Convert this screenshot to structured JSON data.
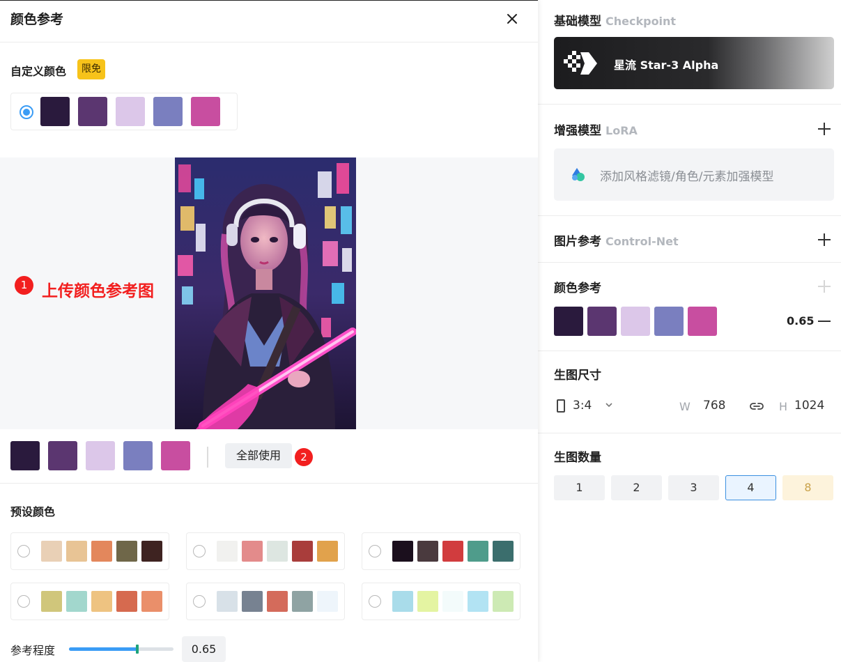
{
  "colors": {
    "accent": "#3a9cf5",
    "danger": "#f21f1f",
    "badge": "#f7c31a",
    "palette": [
      "#2a1a3d",
      "#5b3670",
      "#dcc7e9",
      "#7a7fbf",
      "#c84ea0"
    ]
  },
  "left_panel": {
    "title": "颜色参考",
    "custom": {
      "title": "自定义颜色",
      "badge": "限免"
    },
    "upload": {
      "step": "1",
      "label": "上传颜色参考图",
      "image_alt": "neon-guitar-girl-image"
    },
    "extracted": {
      "use_all_label": "全部使用",
      "step": "2"
    },
    "preset": {
      "title": "预设颜色",
      "palettes": [
        [
          "#e9d0b6",
          "#e8c495",
          "#e3875c",
          "#6f6749",
          "#3e2321"
        ],
        [
          "#f1f1ef",
          "#e38b8b",
          "#dde6e1",
          "#a93d3b",
          "#e1a24c"
        ],
        [
          "#1b0f1d",
          "#4a3a3e",
          "#d13c3e",
          "#4f9c8b",
          "#3b6e6d"
        ],
        [
          "#d0c67b",
          "#a2d7cd",
          "#eec381",
          "#d66a4f",
          "#ea8f6a"
        ],
        [
          "#d8e1e8",
          "#778291",
          "#d46b5b",
          "#8fa3a3",
          "#eef5fb"
        ],
        [
          "#a9dcea",
          "#e4f4a2",
          "#f3fbfb",
          "#b2e3f3",
          "#cdeab4"
        ]
      ]
    },
    "strength": {
      "label": "参考程度",
      "value": "0.65",
      "fraction": 0.65
    }
  },
  "right_panel": {
    "checkpoint": {
      "title": "基础模型",
      "sub": "Checkpoint",
      "model_name": "星流 Star-3 Alpha"
    },
    "lora": {
      "title": "增强模型",
      "sub": "LoRA",
      "placeholder": "添加风格滤镜/角色/元素加强模型"
    },
    "controlnet": {
      "title": "图片参考",
      "sub": "Control-Net"
    },
    "color_ref": {
      "title": "颜色参考",
      "strength": "0.65"
    },
    "size": {
      "title": "生图尺寸",
      "ratio": "3:4",
      "w_label": "W",
      "w_value": "768",
      "h_label": "H",
      "h_value": "1024"
    },
    "count": {
      "title": "生图数量",
      "options": [
        "1",
        "2",
        "3",
        "4",
        "8"
      ],
      "selected": "4"
    }
  }
}
